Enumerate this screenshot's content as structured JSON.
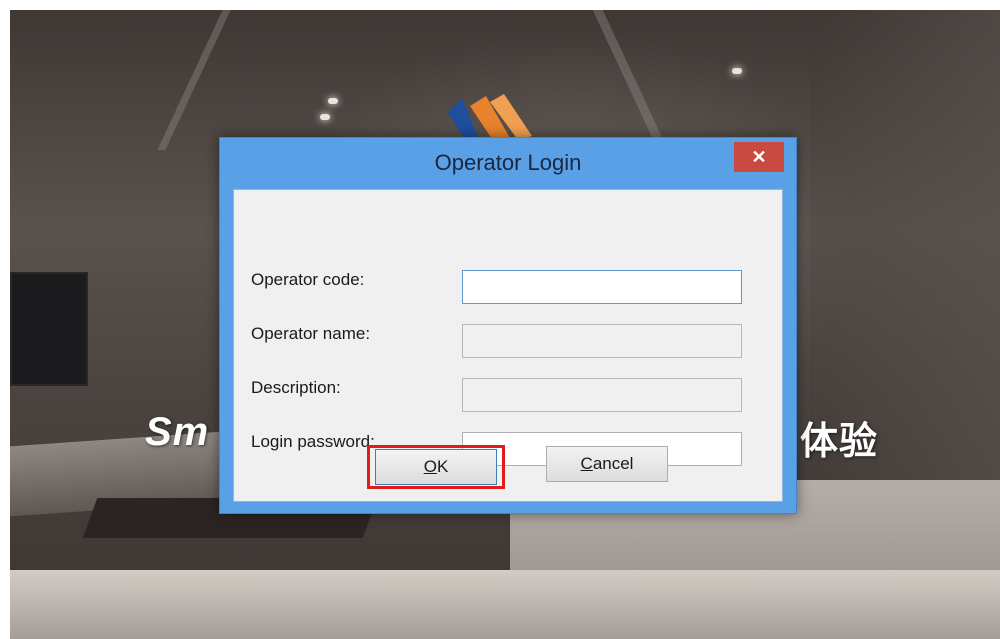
{
  "background": {
    "brand_left": "Sm",
    "brand_right": "体验"
  },
  "dialog": {
    "title": "Operator Login",
    "close_label": "✕",
    "fields": [
      {
        "label": "Operator code:",
        "value": "",
        "state": "active"
      },
      {
        "label": "Operator name:",
        "value": "",
        "state": "disabled"
      },
      {
        "label": "Description:",
        "value": "",
        "state": "disabled"
      },
      {
        "label": "Login password:",
        "value": "",
        "state": "normal"
      }
    ],
    "buttons": {
      "ok_mnemonic": "O",
      "ok_rest": "K",
      "cancel_mnemonic": "C",
      "cancel_rest": "ancel"
    },
    "highlight_color": "#e01b1b",
    "titlebar_color": "#5aa0e6",
    "close_color": "#c94a40"
  }
}
